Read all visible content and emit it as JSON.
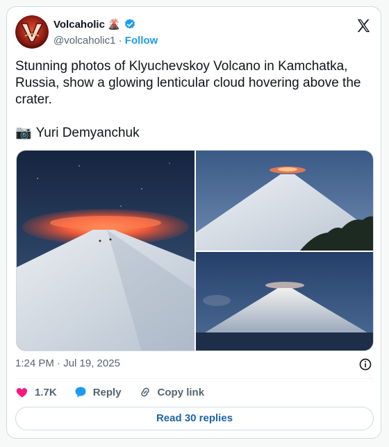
{
  "author": {
    "name": "Volcaholic",
    "name_emoji": "🌋",
    "handle": "@volcaholic1",
    "separator": "·",
    "follow_label": "Follow"
  },
  "tweet": {
    "text": "Stunning photos of Klyuchevskoy Volcano in Kamchatka, Russia, show a glowing lenticular cloud hovering above the crater.",
    "caption_emoji": "📷",
    "caption": "Yuri Demyanchuk"
  },
  "meta": {
    "timestamp": "1:24 PM · Jul 19, 2025"
  },
  "actions": {
    "likes": "1.7K",
    "reply_label": "Reply",
    "copy_label": "Copy link"
  },
  "read_replies_label": "Read 30 replies",
  "icons": {
    "verified": "verified-badge-icon",
    "x_logo": "x-logo-icon",
    "info": "info-icon",
    "heart": "heart-icon",
    "reply": "reply-bubble-icon",
    "link": "link-icon",
    "camera": "camera-icon"
  },
  "colors": {
    "accent": "#1d9bf0",
    "heart": "#f91880",
    "reply": "#1d9bf0",
    "text": "#0f1419",
    "muted": "#536471"
  }
}
